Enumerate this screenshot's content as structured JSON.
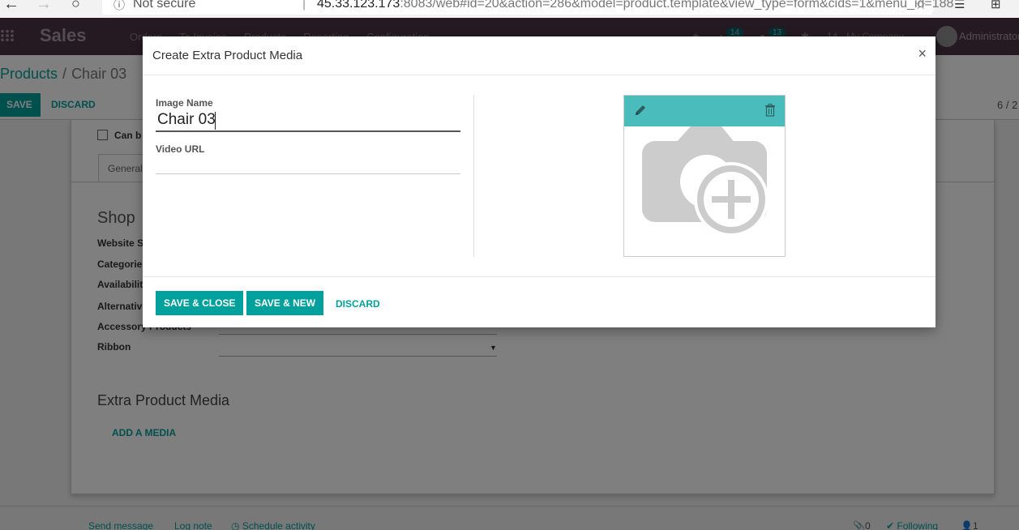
{
  "browser": {
    "back_icon": "arrow-left-icon",
    "forward_icon": "arrow-right-icon",
    "reload_icon": "reload-icon",
    "security_label": "Not secure",
    "url_host": "45.33.123.173",
    "url_rest": ":8083/web#id=20&action=286&model=product.template&view_type=form&cids=1&menu_id=188",
    "favorite_icon": "star-icon"
  },
  "navbar": {
    "app_name": "Sales",
    "menu": [
      "Orders",
      "To Invoice",
      "Products",
      "Reporting",
      "Configuration"
    ],
    "activity_count": "14",
    "message_count": "13",
    "company_short": "14",
    "company": "My Company",
    "user": "Administrator"
  },
  "page": {
    "breadcrumb_parent": "Products",
    "breadcrumb_current": "Chair 03",
    "save_label": "SAVE",
    "discard_label": "DISCARD",
    "pager": "6 / 2",
    "checkbox_label": "Can b",
    "tab_general": "General",
    "shop_title": "Shop",
    "fields": [
      "Website S",
      "Categorie",
      "Availabilit",
      "Alternativ",
      "Accessory Products",
      "Ribbon"
    ],
    "media_title": "Extra Product Media",
    "add_media_label": "ADD A MEDIA"
  },
  "chatter": {
    "send_message": "Send message",
    "log_note": "Log note",
    "schedule_activity": "Schedule activity",
    "attachments": "0",
    "following": "Following",
    "followers": "1"
  },
  "modal": {
    "title": "Create Extra Product Media",
    "close_label": "×",
    "image_name_label": "Image Name",
    "image_name_value": "Chair 03",
    "video_url_label": "Video URL",
    "video_url_value": "",
    "save_close_label": "SAVE & CLOSE",
    "save_new_label": "SAVE & NEW",
    "discard_label": "DISCARD"
  },
  "colors": {
    "primary": "#00a09d",
    "navbar": "#4a3444",
    "image_toolbar": "#4bbcbc"
  }
}
